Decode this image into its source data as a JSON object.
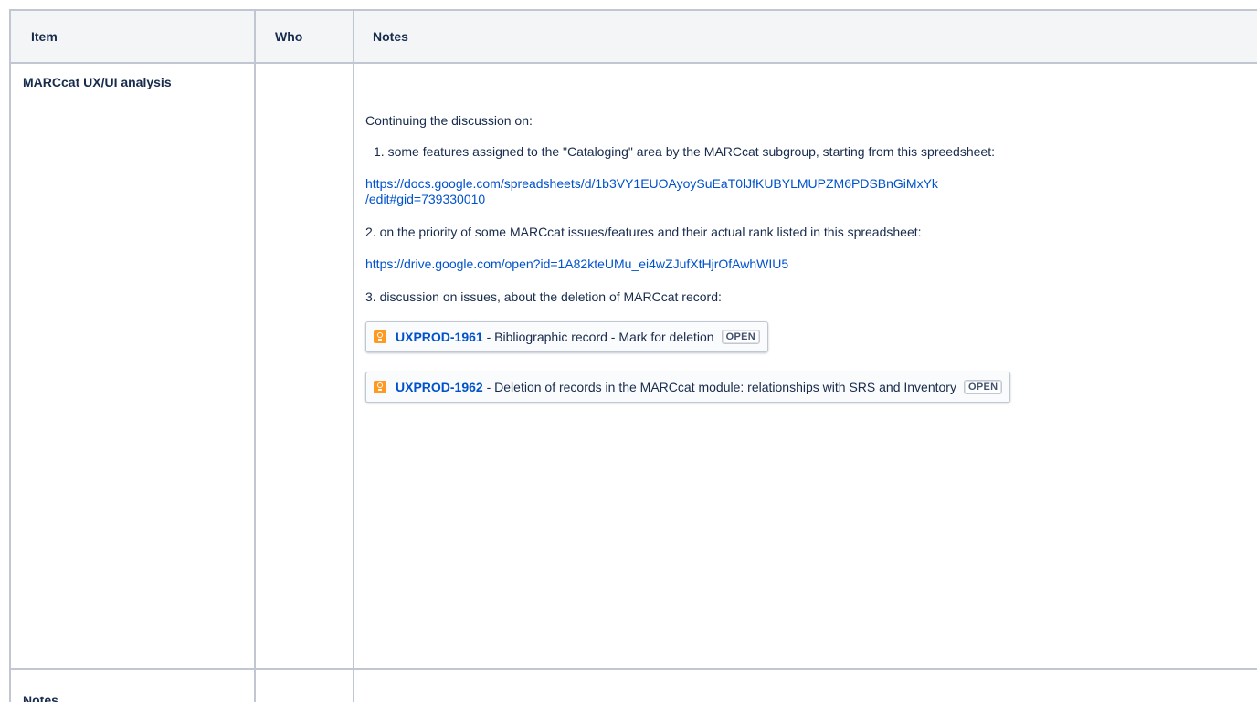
{
  "table": {
    "headers": {
      "item": "Item",
      "who": "Who",
      "notes": "Notes"
    },
    "rows": [
      {
        "item": "MARCcat UX/UI analysis",
        "who": "",
        "intro": "Continuing the discussion  on:",
        "list_number": "1.",
        "list_text": "some features assigned to the \"Cataloging\" area by the MARCcat subgroup, starting from this spreedsheet:",
        "link1_line1": "https://docs.google.com/spreadsheets/d/1b3VY1EUOAyoySuEaT0lJfKUBYLMUPZM6PDSBnGiMxYk",
        "link1_line2": "/edit#gid=739330010",
        "p2": "2.  on the priority of some MARCcat issues/features and their actual rank listed in this spreadsheet:",
        "link2": "https://drive.google.com/open?id=1A82kteUMu_ei4wZJufXtHjrOfAwhWIU5",
        "p3": "3.  discussion on issues, about the deletion of MARCcat record:",
        "issues": [
          {
            "key": "UXPROD-1961",
            "sep": " - ",
            "summary": "Bibliographic record - Mark for deletion",
            "status": "OPEN",
            "icon": "improvement-icon"
          },
          {
            "key": "UXPROD-1962",
            "sep": " - ",
            "summary": "Deletion of records in the MARCcat module: relationships with SRS and Inventory",
            "status": "OPEN",
            "icon": "improvement-icon"
          }
        ]
      },
      {
        "item": "Notes",
        "who": "",
        "notes": ""
      }
    ]
  },
  "colors": {
    "link": "#0052cc",
    "header_bg": "#f4f5f7",
    "border": "#c1c7d0",
    "issue_icon": "#ff991f"
  }
}
